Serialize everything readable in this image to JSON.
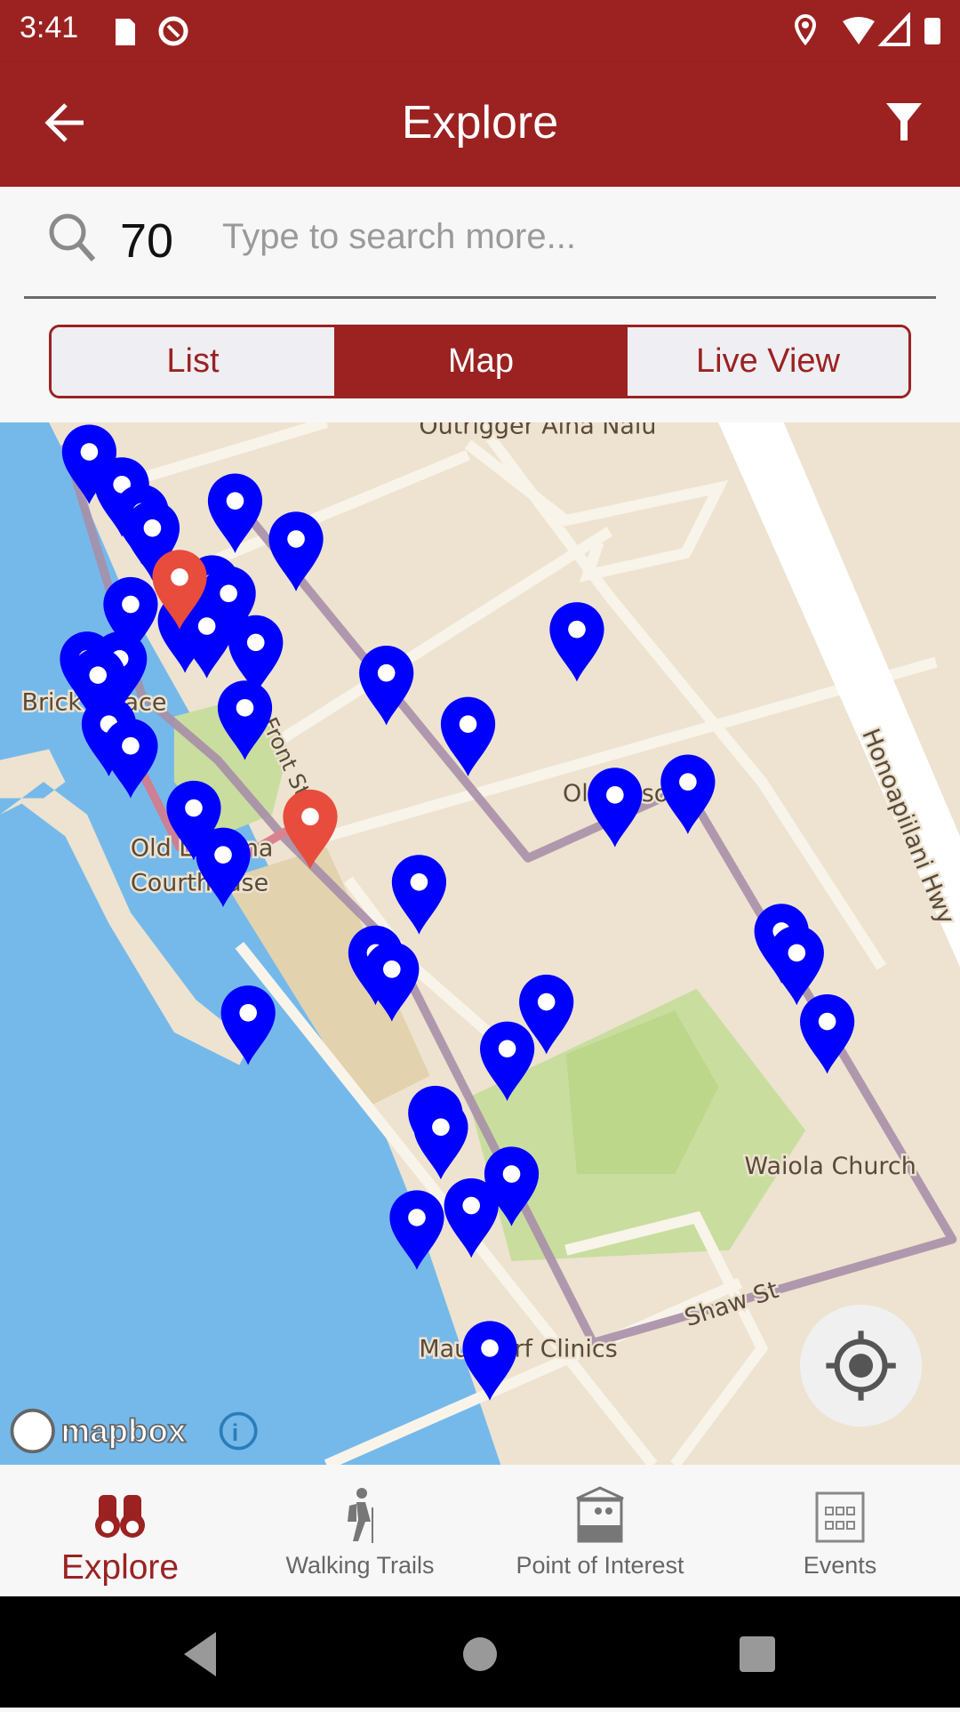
{
  "status_bar": {
    "time": "3:41",
    "icons": [
      "sd-card-icon",
      "at-sign-icon",
      "location-icon",
      "wifi-icon",
      "signal-icon",
      "battery-icon"
    ]
  },
  "app_bar": {
    "title": "Explore",
    "back_icon": "arrow-left-icon",
    "filter_icon": "filter-icon"
  },
  "search": {
    "count": "70",
    "placeholder": "Type to search more...",
    "value": ""
  },
  "view_tabs": [
    {
      "label": "List",
      "active": false
    },
    {
      "label": "Map",
      "active": true
    },
    {
      "label": "Live View",
      "active": false
    }
  ],
  "map": {
    "labels": {
      "outrigger": "Outrigger Aina Nalu",
      "brick_palace": "Brick Palace",
      "old_lahaina_1": "Old Lahaina",
      "old_lahaina_2": "Courthouse",
      "front_st": "Front St",
      "old_prison": "Old Prison",
      "honoapiilani": "Honoapiilani Hwy",
      "waiola": "Waiola Church",
      "shaw": "Shaw St",
      "maui_surf": "Maui Surf Clinics"
    },
    "attribution": "mapbox",
    "marker_colors": {
      "default": "#0000ff",
      "selected": "#e84c3d"
    },
    "locate_icon": "crosshair-icon",
    "info_icon": "info-icon"
  },
  "bottom_nav": [
    {
      "label": "Explore",
      "icon": "binoculars-icon",
      "active": true
    },
    {
      "label": "Walking Trails",
      "icon": "hiker-icon",
      "active": false
    },
    {
      "label": "Point of Interest",
      "icon": "kiosk-icon",
      "active": false
    },
    {
      "label": "Events",
      "icon": "calendar-icon",
      "active": false
    }
  ],
  "colors": {
    "brand": "#9b2221",
    "water": "#75b9eb",
    "land": "#ede3d0",
    "park": "#c9dd9f",
    "trail": "#a78fa8"
  }
}
